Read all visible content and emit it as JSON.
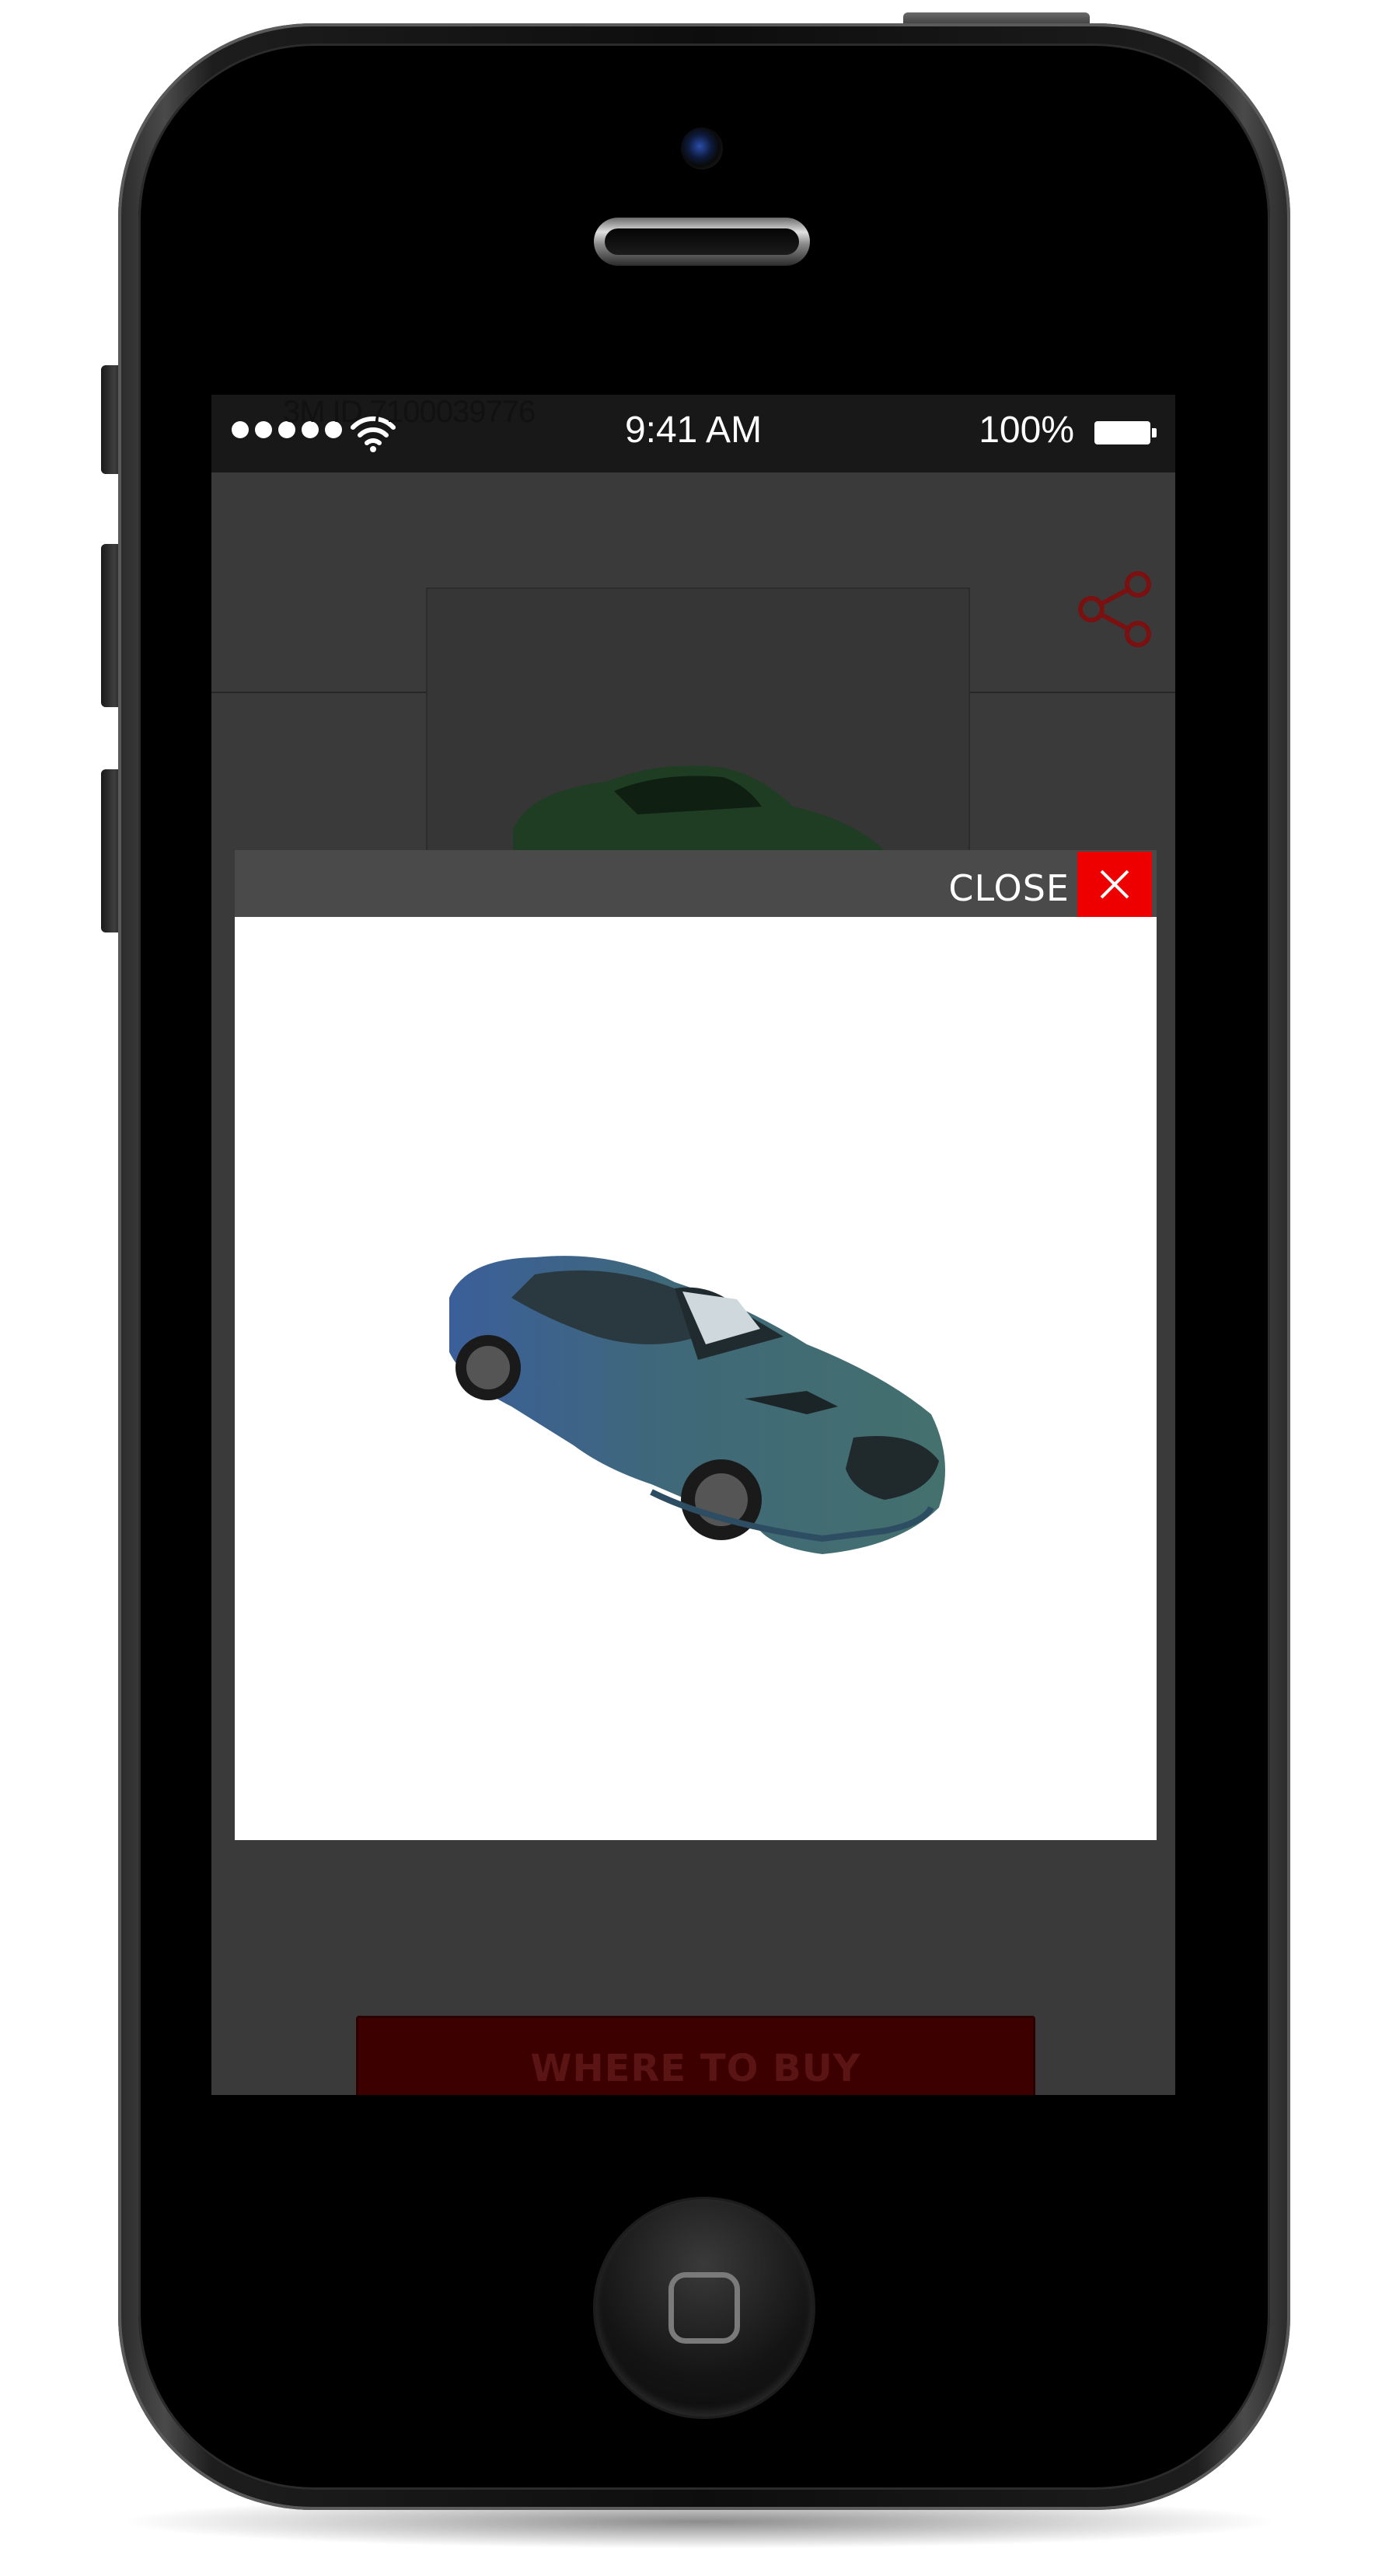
{
  "device": {
    "model": "iPhone mockup"
  },
  "status_bar": {
    "overlay_id": "3M ID 7100039776",
    "time": "9:41 AM",
    "battery_percent": "100%",
    "signal_dots": 5,
    "icons": [
      "signal-dots-icon",
      "wifi-icon",
      "battery-icon"
    ]
  },
  "header": {
    "share_icon": "share-icon"
  },
  "background_product": {
    "image": "car-thumbnail-green"
  },
  "modal": {
    "close_label": "CLOSE",
    "close_icon": "close-icon",
    "image": "car-3d-render-blue-green",
    "colors": {
      "close_bg": "#ee0000",
      "header_bg": "#4a4a4a",
      "body_bg": "#ffffff"
    }
  },
  "footer": {
    "buy_label": "WHERE TO BUY",
    "buy_color": "#3d0000"
  }
}
